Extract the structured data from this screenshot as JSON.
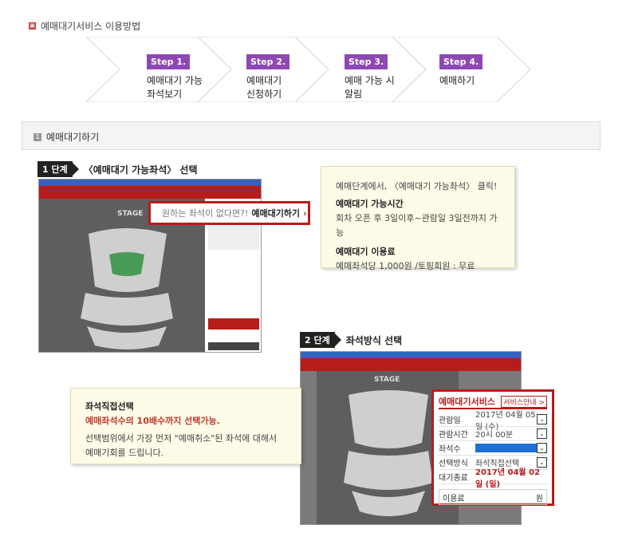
{
  "header": {
    "title": "예매대기서비스 이용방법"
  },
  "steps": [
    {
      "badge": "Step 1.",
      "line1": "예매대기 가능",
      "line2": "좌석보기"
    },
    {
      "badge": "Step 2.",
      "line1": "예매대기",
      "line2": "신청하기"
    },
    {
      "badge": "Step 3.",
      "line1": "예매 가능 시",
      "line2": "알림"
    },
    {
      "badge": "Step 4.",
      "line1": "예매하기",
      "line2": ""
    }
  ],
  "section": {
    "num": "1",
    "title": "예매대기하기"
  },
  "stage1": {
    "label": "1 단계",
    "title": "〈예매대기 가능좌석〉 선택",
    "stage_text": "STAGE",
    "banner_q": "원하는 좌석이 없다면?!",
    "banner_btn": "예매대기하기",
    "callout": {
      "intro": "예매단계에서, 〈예매대기 가능좌석〉 클릭!",
      "h1": "예매대기 가능시간",
      "p1": "회차 오픈 후 3일이후~관람일 3일전까지 가능",
      "h2": "예매대기 이용료",
      "p2a": "예매좌석당 1,000원",
      "p2b": "/토핑회원 : 무료"
    }
  },
  "stage2": {
    "label": "2 단계",
    "title": "좌석방식 선택",
    "stage_text": "STAGE",
    "callout": {
      "h": "좌석직접선택",
      "red": "예매좌석수의 10배수까지 선택가능.",
      "p1": "선택범위에서 가장 먼저 \"예매취소\"된 좌석에 대해서",
      "p2": "예매기회를 드립니다."
    },
    "panel": {
      "title": "예매대기서비스",
      "guide_btn": "서비스안내 >",
      "rows": [
        {
          "k": "관람일",
          "v": "2017년 04월 05일 (수)"
        },
        {
          "k": "관람시간",
          "v": "20시 00분"
        },
        {
          "k": "좌석수",
          "v": ""
        },
        {
          "k": "선택방식",
          "v": "좌석직접선택"
        }
      ],
      "end_k": "대기종료",
      "end_v": "2017년 04월 02일 (일)",
      "fee_k": "이용료",
      "fee_unit": "원"
    }
  }
}
